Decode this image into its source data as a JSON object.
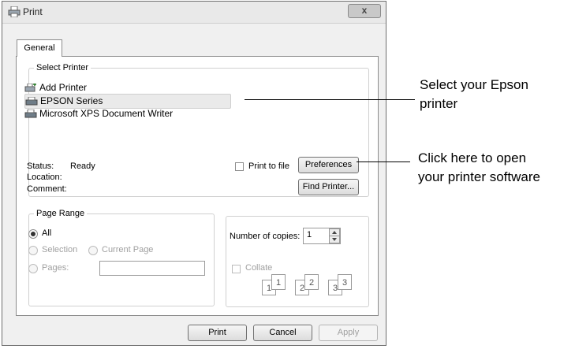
{
  "window": {
    "title": "Print",
    "close_label": "x"
  },
  "tabs": [
    {
      "label": "General"
    }
  ],
  "select_printer": {
    "legend": "Select Printer",
    "items": [
      {
        "label": "Add Printer",
        "icon": "add-printer-icon"
      },
      {
        "label": "EPSON Series",
        "icon": "printer-icon",
        "selected": true
      },
      {
        "label": "Microsoft XPS Document Writer",
        "icon": "printer-icon"
      }
    ],
    "status_label": "Status:",
    "status_value": "Ready",
    "location_label": "Location:",
    "comment_label": "Comment:",
    "print_to_file_label": "Print to file",
    "preferences_label": "Preferences",
    "find_printer_label": "Find Printer..."
  },
  "page_range": {
    "legend": "Page Range",
    "all_label": "All",
    "selection_label": "Selection",
    "current_page_label": "Current Page",
    "pages_label": "Pages:",
    "pages_value": ""
  },
  "copies": {
    "number_label": "Number of copies:",
    "number_value": "1",
    "collate_label": "Collate",
    "collate_pages": [
      "1",
      "1",
      "2",
      "2",
      "3",
      "3"
    ]
  },
  "footer": {
    "print_label": "Print",
    "cancel_label": "Cancel",
    "apply_label": "Apply"
  },
  "callouts": {
    "select_printer_line1": "Select your Epson",
    "select_printer_line2": "printer",
    "open_software_line1": "Click here to open",
    "open_software_line2": "your printer software"
  }
}
